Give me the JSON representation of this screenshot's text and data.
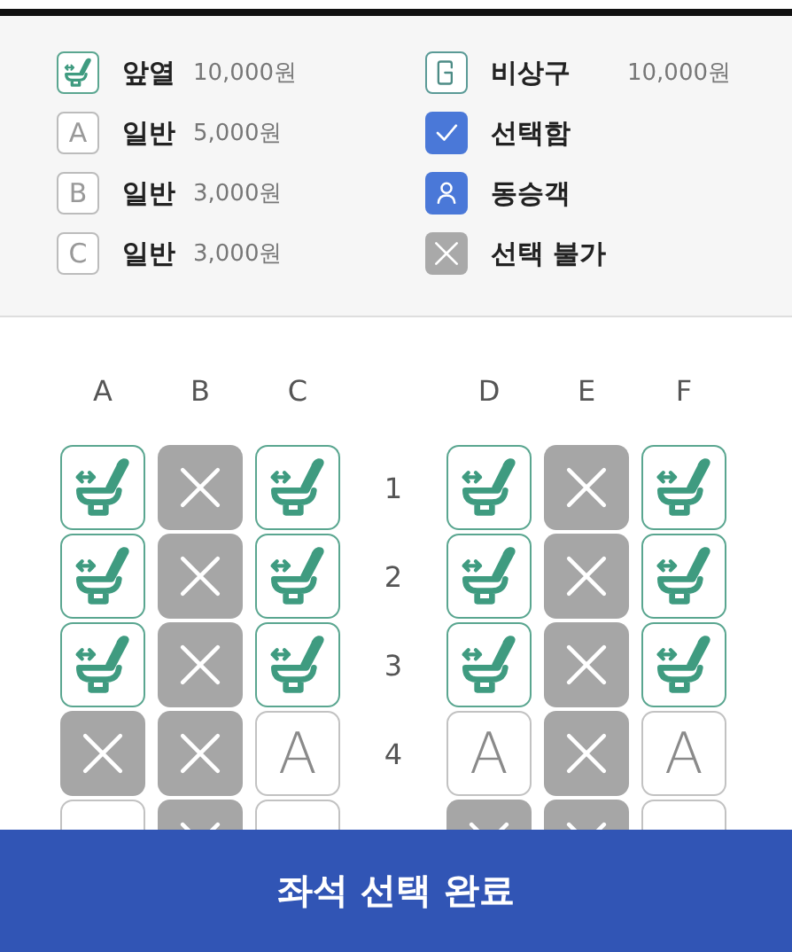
{
  "legend": [
    {
      "kind": "front",
      "label": "앞열",
      "price": "10,000원"
    },
    {
      "kind": "exit",
      "label": "비상구",
      "price": "10,000원"
    },
    {
      "kind": "grade",
      "mark": "A",
      "label": "일반",
      "price": "5,000원"
    },
    {
      "kind": "selected",
      "label": "선택함"
    },
    {
      "kind": "grade",
      "mark": "B",
      "label": "일반",
      "price": "3,000원"
    },
    {
      "kind": "companion",
      "label": "동승객"
    },
    {
      "kind": "grade",
      "mark": "C",
      "label": "일반",
      "price": "3,000원"
    },
    {
      "kind": "blocked",
      "label": "선택 불가"
    }
  ],
  "seat_map": {
    "columns": [
      "A",
      "B",
      "C",
      "D",
      "E",
      "F"
    ],
    "rows": [
      {
        "number": "1",
        "seats": [
          {
            "kind": "front"
          },
          {
            "kind": "blocked"
          },
          {
            "kind": "front"
          },
          {
            "kind": "front"
          },
          {
            "kind": "blocked"
          },
          {
            "kind": "front"
          }
        ]
      },
      {
        "number": "2",
        "seats": [
          {
            "kind": "front"
          },
          {
            "kind": "blocked"
          },
          {
            "kind": "front"
          },
          {
            "kind": "front"
          },
          {
            "kind": "blocked"
          },
          {
            "kind": "front"
          }
        ]
      },
      {
        "number": "3",
        "seats": [
          {
            "kind": "front"
          },
          {
            "kind": "blocked"
          },
          {
            "kind": "front"
          },
          {
            "kind": "front"
          },
          {
            "kind": "blocked"
          },
          {
            "kind": "front"
          }
        ]
      },
      {
        "number": "4",
        "seats": [
          {
            "kind": "blocked"
          },
          {
            "kind": "blocked"
          },
          {
            "kind": "grade",
            "mark": "A"
          },
          {
            "kind": "grade",
            "mark": "A"
          },
          {
            "kind": "blocked"
          },
          {
            "kind": "grade",
            "mark": "A"
          }
        ]
      },
      {
        "seats": [
          {
            "kind": "grade"
          },
          {
            "kind": "blocked"
          },
          {
            "kind": "grade"
          },
          {
            "kind": "blocked"
          },
          {
            "kind": "blocked"
          },
          {
            "kind": "grade"
          }
        ]
      }
    ]
  },
  "confirm_button": "좌석 선택 완료"
}
